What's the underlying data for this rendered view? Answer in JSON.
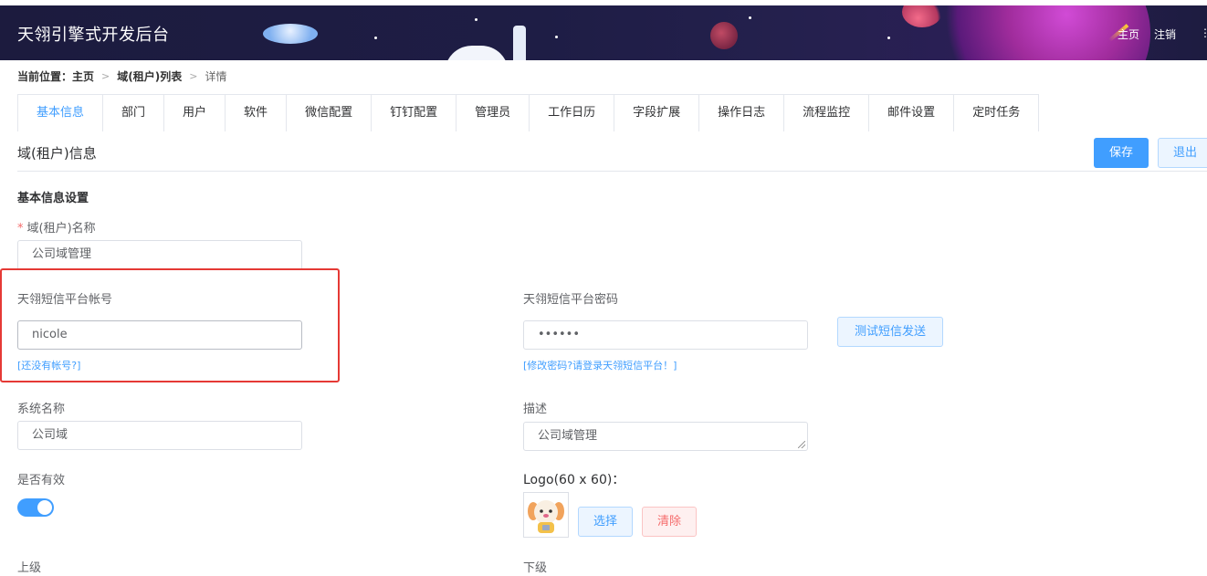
{
  "header": {
    "title": "天翎引擎式开发后台",
    "nav": [
      "主页",
      "注销"
    ],
    "more": "⋮"
  },
  "breadcrumb": {
    "label": "当前位置：",
    "items": [
      "主页",
      "域(租户)列表",
      "详情"
    ],
    "separator": ">"
  },
  "tabs": [
    "基本信息",
    "部门",
    "用户",
    "软件",
    "微信配置",
    "钉钉配置",
    "管理员",
    "工作日历",
    "字段扩展",
    "操作日志",
    "流程监控",
    "邮件设置",
    "定时任务"
  ],
  "active_tab": "基本信息",
  "section": {
    "title": "域(租户)信息",
    "save_label": "保存",
    "exit_label": "退出"
  },
  "form": {
    "subheading": "基本信息设置",
    "required_mark": "*",
    "domain_name_label": "域(租户)名称",
    "domain_name_value": "公司域管理",
    "sms_account_label": "天翎短信平台帐号",
    "sms_account_value": "nicole",
    "sms_account_link": "[还没有帐号?]",
    "sms_password_label": "天翎短信平台密码",
    "sms_password_value": "••••••",
    "sms_password_link": "[修改密码?请登录天翎短信平台！]",
    "test_sms_label": "测试短信发送",
    "system_name_label": "系统名称",
    "system_name_value": "公司域",
    "description_label": "描述",
    "description_value": "公司域管理",
    "active_label": "是否有效",
    "active_value": true,
    "logo_label": "Logo(60 x 60)：",
    "choose_label": "选择",
    "clear_label": "清除",
    "superior_label": "上级",
    "subordinate_label": "下级"
  },
  "colors": {
    "primary": "#409eff",
    "danger": "#f56c6c",
    "highlight": "#e53935",
    "header_bg": "#1e1d45"
  }
}
